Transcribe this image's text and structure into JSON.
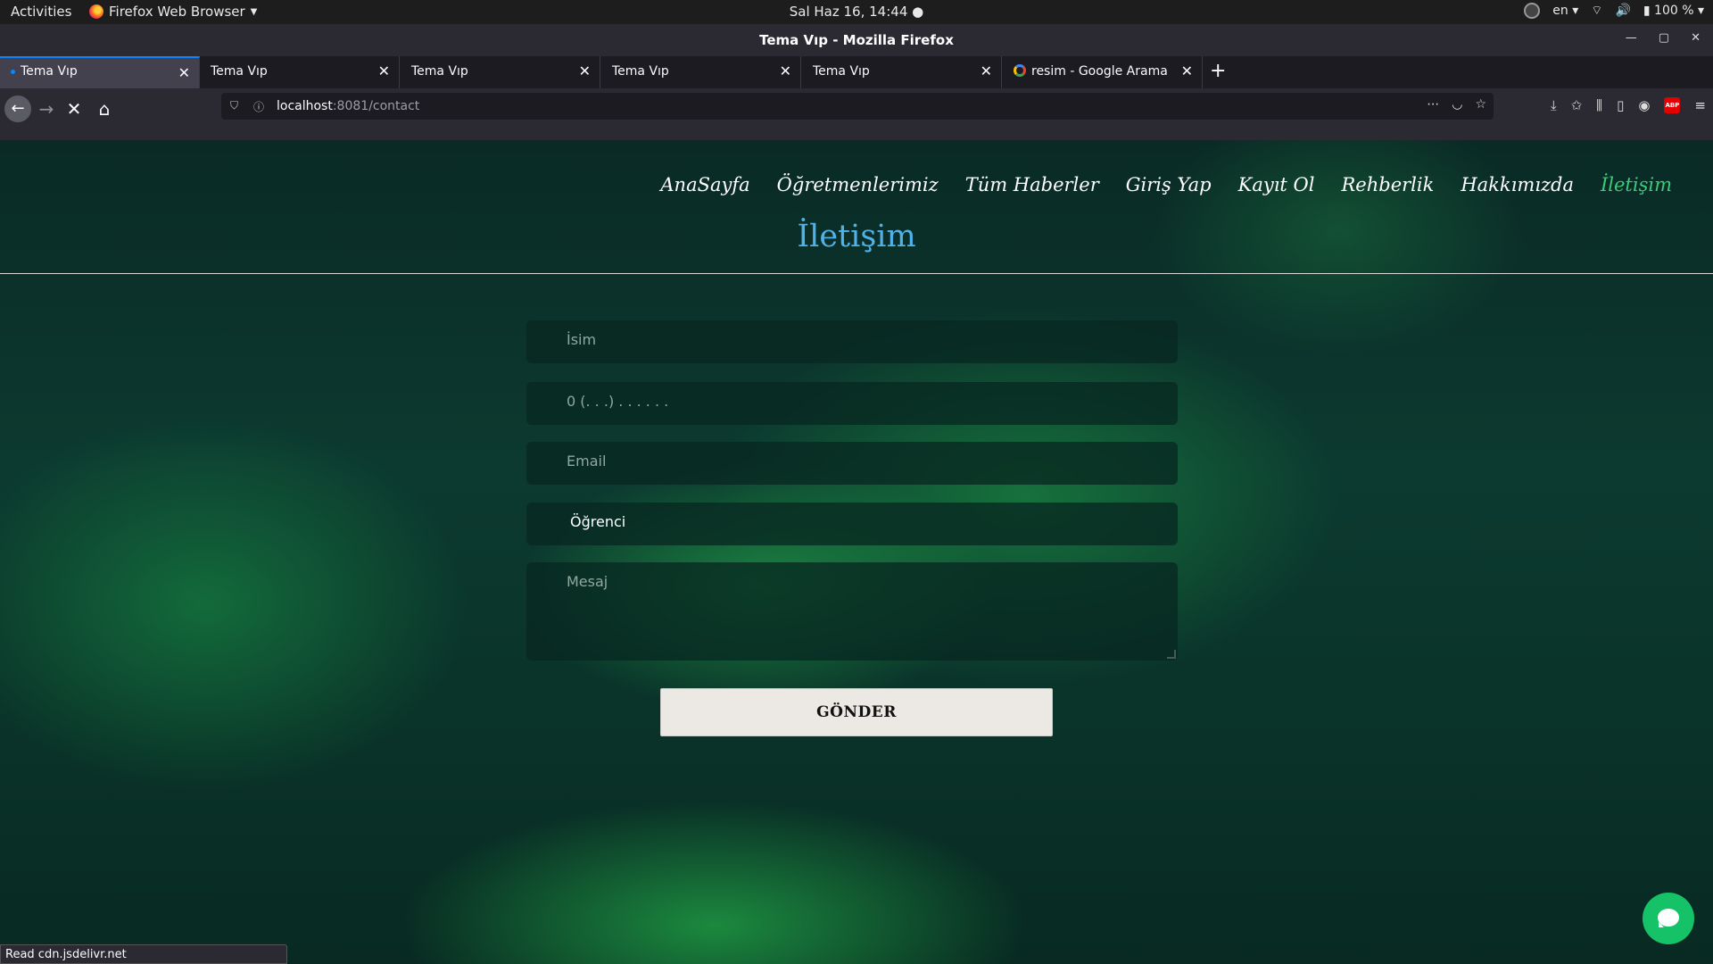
{
  "system": {
    "activities": "Activities",
    "app_name": "Firefox Web Browser",
    "clock": "Sal Haz 16, 14:44",
    "language": "en",
    "battery": "100 %"
  },
  "window": {
    "title": "Tema Vıp - Mozilla Firefox"
  },
  "tabs": [
    {
      "label": "Tema Vıp"
    },
    {
      "label": "Tema Vıp"
    },
    {
      "label": "Tema Vıp"
    },
    {
      "label": "Tema Vıp"
    },
    {
      "label": "Tema Vıp"
    },
    {
      "label": "resim - Google Arama"
    }
  ],
  "urlbar": {
    "host": "localhost",
    "rest": ":8081/contact"
  },
  "site": {
    "menu": [
      "AnaSayfa",
      "Öğretmenlerimiz",
      "Tüm Haberler",
      "Giriş Yap",
      "Kayıt Ol",
      "Rehberlik",
      "Hakkımızda",
      "İletişim"
    ],
    "heading": "İletişim",
    "form": {
      "name_placeholder": "İsim",
      "phone_placeholder": "0 (. . .)  . . .  . . .",
      "email_placeholder": "Email",
      "role_selected": "Öğrenci",
      "message_placeholder": "Mesaj",
      "submit_label": "GÖNDER"
    },
    "accent_color": "#3ccd7a",
    "heading_color": "#4fb3ea"
  },
  "status": "Read cdn.jsdelivr.net"
}
